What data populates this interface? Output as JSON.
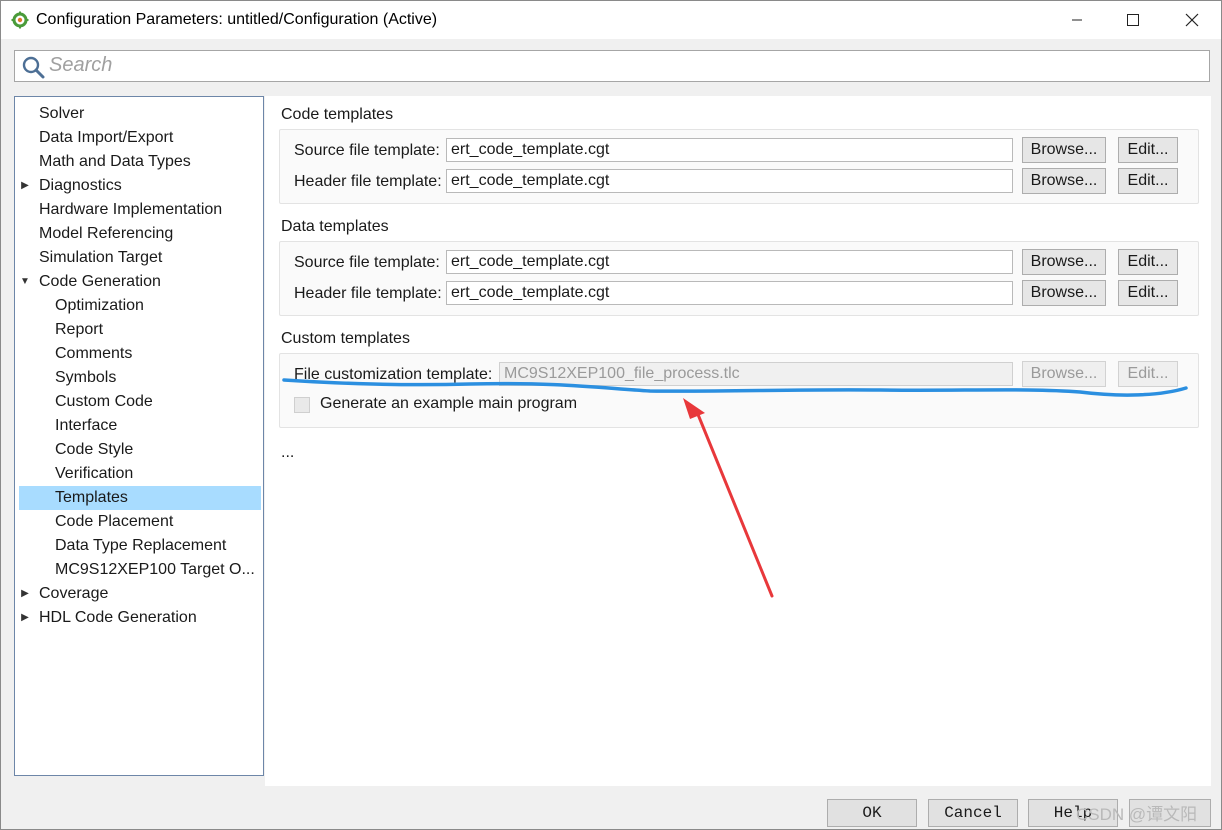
{
  "window": {
    "title": "Configuration Parameters: untitled/Configuration (Active)",
    "minimize_icon": "minimize-icon",
    "maximize_icon": "maximize-icon",
    "close_icon": "close-icon"
  },
  "search": {
    "placeholder": "Search",
    "value": ""
  },
  "tree": {
    "items": [
      {
        "label": "Solver",
        "level": 0,
        "expander": "none"
      },
      {
        "label": "Data Import/Export",
        "level": 0,
        "expander": "none"
      },
      {
        "label": "Math and Data Types",
        "level": 0,
        "expander": "none"
      },
      {
        "label": "Diagnostics",
        "level": 0,
        "expander": "collapsed"
      },
      {
        "label": "Hardware Implementation",
        "level": 0,
        "expander": "none"
      },
      {
        "label": "Model Referencing",
        "level": 0,
        "expander": "none"
      },
      {
        "label": "Simulation Target",
        "level": 0,
        "expander": "none"
      },
      {
        "label": "Code Generation",
        "level": 0,
        "expander": "expanded"
      },
      {
        "label": "Optimization",
        "level": 1,
        "expander": "none"
      },
      {
        "label": "Report",
        "level": 1,
        "expander": "none"
      },
      {
        "label": "Comments",
        "level": 1,
        "expander": "none"
      },
      {
        "label": "Symbols",
        "level": 1,
        "expander": "none"
      },
      {
        "label": "Custom Code",
        "level": 1,
        "expander": "none"
      },
      {
        "label": "Interface",
        "level": 1,
        "expander": "none"
      },
      {
        "label": "Code Style",
        "level": 1,
        "expander": "none"
      },
      {
        "label": "Verification",
        "level": 1,
        "expander": "none"
      },
      {
        "label": "Templates",
        "level": 1,
        "expander": "none",
        "selected": true
      },
      {
        "label": "Code Placement",
        "level": 1,
        "expander": "none"
      },
      {
        "label": "Data Type Replacement",
        "level": 1,
        "expander": "none"
      },
      {
        "label": "MC9S12XEP100 Target O...",
        "level": 1,
        "expander": "none"
      },
      {
        "label": "Coverage",
        "level": 0,
        "expander": "collapsed"
      },
      {
        "label": "HDL Code Generation",
        "level": 0,
        "expander": "collapsed"
      }
    ]
  },
  "code_templates": {
    "title": "Code templates",
    "source_label": "Source file template:",
    "source_value": "ert_code_template.cgt",
    "header_label": "Header file template:",
    "header_value": "ert_code_template.cgt",
    "browse_label": "Browse...",
    "edit_label": "Edit..."
  },
  "data_templates": {
    "title": "Data templates",
    "source_label": "Source file template:",
    "source_value": "ert_code_template.cgt",
    "header_label": "Header file template:",
    "header_value": "ert_code_template.cgt",
    "browse_label": "Browse...",
    "edit_label": "Edit..."
  },
  "custom_templates": {
    "title": "Custom templates",
    "file_label": "File customization template:",
    "file_value": "MC9S12XEP100_file_process.tlc",
    "browse_label": "Browse...",
    "edit_label": "Edit...",
    "generate_main_label": "Generate an example main program",
    "generate_main_checked": false
  },
  "more_text": "...",
  "buttons": {
    "ok": "OK",
    "cancel": "Cancel",
    "help": "Help"
  },
  "watermark": "CSDN @谭文阳",
  "annotations": {
    "underline_color": "#2b8fe0",
    "arrow_color": "#e8383b"
  }
}
